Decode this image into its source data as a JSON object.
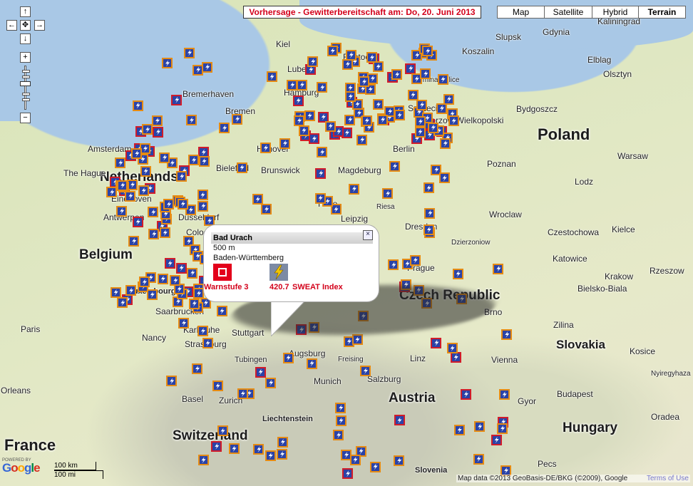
{
  "header": {
    "forecast_title": "Vorhersage - Gewitterbereitschaft am: Do, 20. Juni 2013",
    "map_types": [
      {
        "label": "Map",
        "active": false
      },
      {
        "label": "Satellite",
        "active": false
      },
      {
        "label": "Hybrid",
        "active": false
      },
      {
        "label": "Terrain",
        "active": true
      }
    ]
  },
  "controls": {
    "pan_up": "↑",
    "pan_left": "←",
    "pan_center": "✥",
    "pan_right": "→",
    "pan_down": "↓",
    "zoom_in": "+",
    "zoom_out": "−"
  },
  "countries": [
    "Poland",
    "Netherlands",
    "Belgium",
    "Czech Republic",
    "France",
    "Switzerland",
    "Austria",
    "Hungary",
    "Slovakia"
  ],
  "cities": [
    "Gdynia",
    "Kaliningrad",
    "Slupsk",
    "Koszalin",
    "Elblag",
    "Olsztyn",
    "Kiel",
    "Rostock",
    "Lubeck",
    "Gmina Police",
    "Hamburg",
    "Bremerhaven",
    "Bremen",
    "Szczecin",
    "Bydgoszcz",
    "Gorzow Wielkopolski",
    "Amsterdam",
    "Hanover",
    "Berlin",
    "Warsaw",
    "The Hague",
    "Bielefeld",
    "Brunswick",
    "Magdeburg",
    "Poznan",
    "Lodz",
    "Eindhoven",
    "Antwerpen",
    "Dusseldorf",
    "Halle",
    "Leipzig",
    "Riesa",
    "Wroclaw",
    "Kielce",
    "Cologne",
    "Dresden",
    "Czestochowa",
    "Katowice",
    "Bad Urach",
    "Dzierzoniow",
    "Prague",
    "Krakow",
    "Rzeszow",
    "Luxembourg",
    "Bielsko-Biala",
    "Brno",
    "Saarbrucken",
    "Paris",
    "Karlsruhe",
    "Stuttgart",
    "Nancy",
    "Strasbourg",
    "Tubingen",
    "Augsburg",
    "Freising",
    "Munich",
    "Linz",
    "Salzburg",
    "Vienna",
    "Kosice",
    "Zilina",
    "Orleans",
    "Basel",
    "Zurich",
    "Budapest",
    "Gyor",
    "Liechtenstein",
    "Nyiregyhaza",
    "Oradea",
    "Slovenia",
    "Pecs"
  ],
  "popup": {
    "title": "Bad Urach",
    "altitude": "500 m",
    "region": "Baden-Württemberg",
    "warn_label": "Warnstufe 3",
    "sweat_value": "420.7",
    "sweat_label": "SWEAT Index",
    "close_label": "×"
  },
  "footer": {
    "powered_by": "POWERED BY",
    "google": "Google",
    "scale_km": "100 km",
    "scale_mi": "100 mi",
    "copyright": "Map data ©2013 GeoBasis-DE/BKG (©2009), Google",
    "terms": "Terms of Use"
  },
  "colors": {
    "warn_red": "#d3001a",
    "marker_blue": "#2a43a8",
    "marker_orange": "#e58b14",
    "marker_red": "#d11c2a"
  },
  "markers": {
    "red_count": 53,
    "orange_count": 205
  }
}
